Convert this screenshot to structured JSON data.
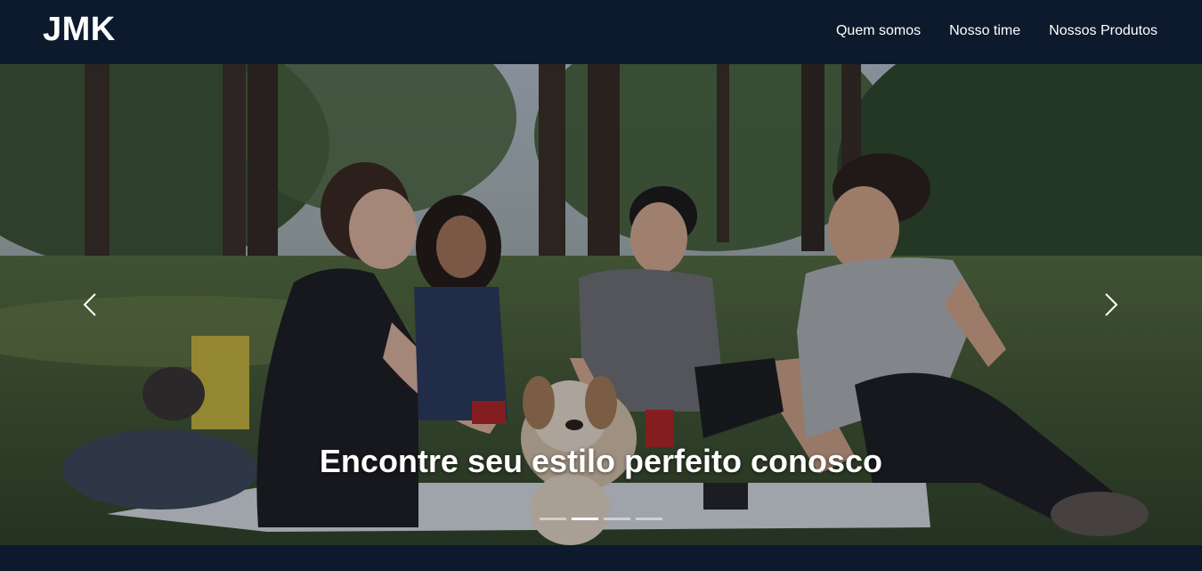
{
  "navbar": {
    "brand": "JMK",
    "links": [
      {
        "label": "Quem somos"
      },
      {
        "label": "Nosso time"
      },
      {
        "label": "Nossos Produtos"
      }
    ]
  },
  "carousel": {
    "caption": "Encontre seu estilo perfeito conosco",
    "image": "friends-picnic-in-park-with-dog",
    "prev_icon": "chevron-left-icon",
    "next_icon": "chevron-right-icon",
    "slide_count": 4,
    "active_slide": 2
  },
  "colors": {
    "navbar_bg": "#0d1a2d",
    "text": "#ffffff"
  }
}
